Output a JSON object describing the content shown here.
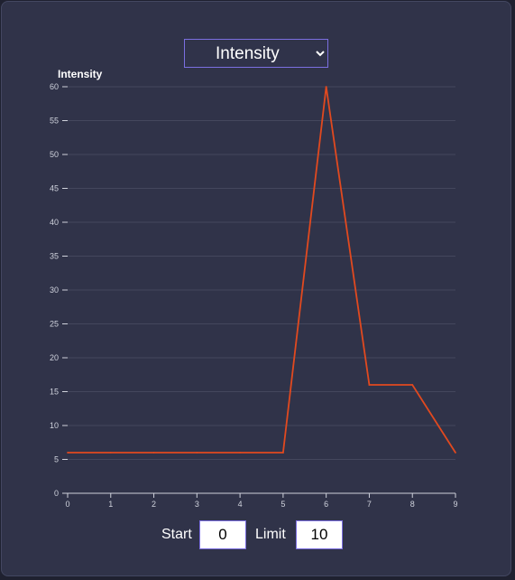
{
  "selector": {
    "selected": "Intensity",
    "options": [
      "Intensity"
    ]
  },
  "controls": {
    "start_label": "Start",
    "start_value": "0",
    "limit_label": "Limit",
    "limit_value": "10"
  },
  "colors": {
    "line": "#e1491f",
    "axis": "#cfd2dc",
    "grid": "#44475d",
    "accent": "#7b6fe0"
  },
  "chart_data": {
    "type": "line",
    "ylabel": "Intensity",
    "x": [
      0,
      1,
      2,
      3,
      4,
      5,
      6,
      7,
      8,
      9
    ],
    "y": [
      6,
      6,
      6,
      6,
      6,
      6,
      60,
      16,
      16,
      6
    ],
    "xlim": [
      0,
      9
    ],
    "ylim": [
      0,
      60
    ],
    "xticks": [
      0,
      1,
      2,
      3,
      4,
      5,
      6,
      7,
      8,
      9
    ],
    "yticks": [
      0,
      5,
      10,
      15,
      20,
      25,
      30,
      35,
      40,
      45,
      50,
      55,
      60
    ],
    "grid": true
  }
}
